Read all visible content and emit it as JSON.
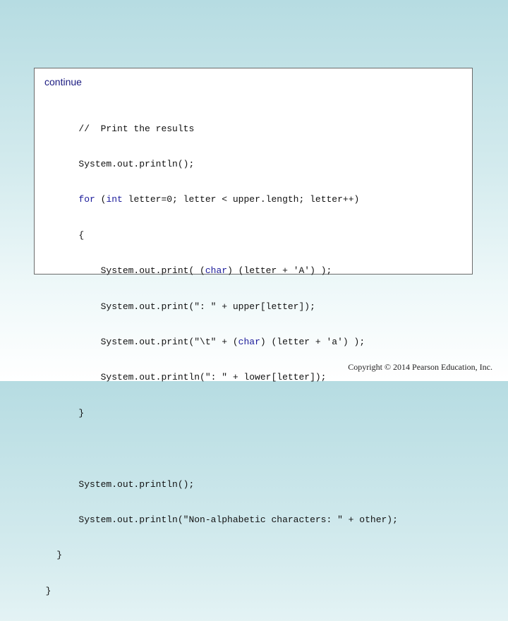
{
  "header": {
    "continue_label": "continue"
  },
  "code": {
    "comment": "//  Print the results",
    "println_empty_1": "System.out.println();",
    "for_kw": "for",
    "for_paren": " (",
    "for_int_kw": "int",
    "for_rest": " letter=0; letter < upper.length; letter++)",
    "open_brace": "{",
    "print1_pre": "System.out.print( (",
    "print1_char_kw": "char",
    "print1_post": ") (letter + 'A') );",
    "print2": "System.out.print(\": \" + upper[letter]);",
    "print3_pre": "System.out.print(\"\\t\" + (",
    "print3_char_kw": "char",
    "print3_post": ") (letter + 'a') );",
    "print4": "System.out.println(\": \" + lower[letter]);",
    "close_brace_inner": "}",
    "println_empty_2": "System.out.println();",
    "println_nonalpha": "System.out.println(\"Non-alphabetic characters: \" + other);",
    "close_brace_method": "}",
    "close_brace_class": "}"
  },
  "footer": {
    "copyright": "Copyright © 2014 Pearson Education, Inc."
  },
  "colors": {
    "keyword": "#1a1a9a",
    "continue": "#1a1a80",
    "background_top": "#b6dce2"
  }
}
